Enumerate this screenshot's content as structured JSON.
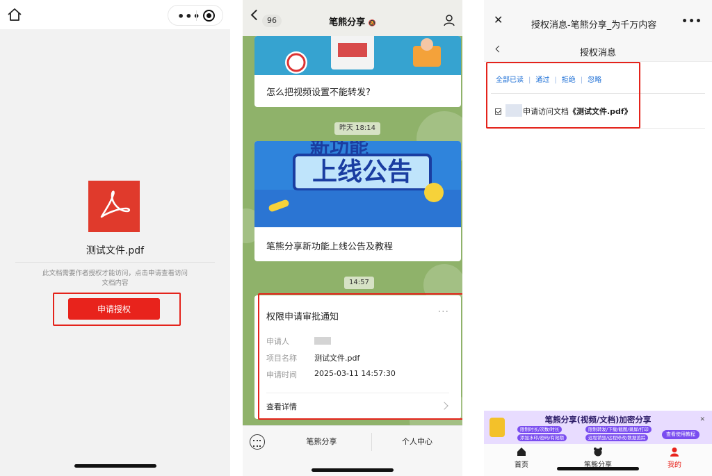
{
  "panel1": {
    "file_name": "测试文件.pdf",
    "hint": "此文档需要作者授权才能访问，点击申请查看访问文档内容",
    "auth_button": "申请授权",
    "icon_home": "home-icon",
    "icon_more": "more-dots-icon",
    "icon_target": "target-icon",
    "pdf_color": "#e03a2c",
    "button_color": "#e8231c"
  },
  "panel2": {
    "unread_count": "96",
    "title": "笔熊分享",
    "card1_title": "怎么把视频设置不能转发?",
    "time1": "昨天 18:14",
    "card2_banner_top": "新功能",
    "card2_banner": "上线公告",
    "card2_title": "笔熊分享新功能上线公告及教程",
    "time2": "14:57",
    "notice": {
      "title": "权限申请审批通知",
      "more": "···",
      "applicant_label": "申请人",
      "project_label": "项目名称",
      "project_value": "测试文件.pdf",
      "time_label": "申请时间",
      "time_value": "2025-03-11 14:57:30",
      "detail": "查看详情"
    },
    "menu": [
      "笔熊分享",
      "个人中心"
    ]
  },
  "panel3": {
    "title": "授权消息-笔熊分享_为千万内容",
    "subtitle": "授权消息",
    "actions": [
      "全部已读",
      "通过",
      "拒绝",
      "忽略"
    ],
    "request_text": "申请访问文档",
    "request_doc": "《测试文件.pdf》",
    "promo": {
      "title": "笔熊分享(视频/文档)加密分享",
      "chips": [
        "限制时长/次数/时长",
        "限制转发/下载/截图/录屏/打印",
        "添加水印/密码/有效期",
        "远程销毁/远程修改/数据追踪"
      ],
      "tutorial": "查看使用教程"
    },
    "tabs": [
      "首页",
      "笔熊分享",
      "我的"
    ],
    "accent": "#1d6fd6",
    "highlight_color": "#e4231b"
  }
}
